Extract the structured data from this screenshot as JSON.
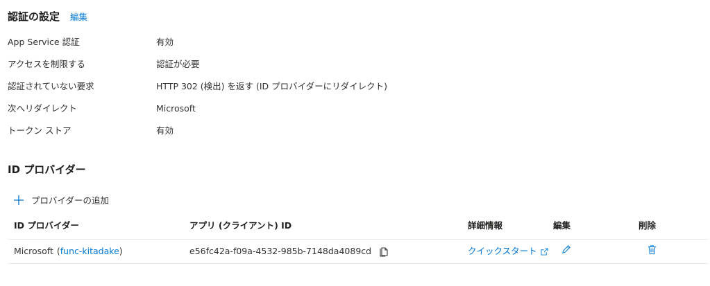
{
  "auth_settings": {
    "title": "認証の設定",
    "edit_label": "編集",
    "rows": [
      {
        "label": "App Service 認証",
        "value": "有効"
      },
      {
        "label": "アクセスを制限する",
        "value": "認証が必要"
      },
      {
        "label": "認証されていない要求",
        "value": "HTTP 302 (検出) を返す (ID プロバイダーにリダイレクト)"
      },
      {
        "label": "次へリダイレクト",
        "value": "Microsoft"
      },
      {
        "label": "トークン ストア",
        "value": "有効"
      }
    ]
  },
  "identity_providers": {
    "title": "ID プロバイダー",
    "add_label": "プロバイダーの追加",
    "columns": {
      "provider": "ID プロバイダー",
      "client_id": "アプリ (クライアント) ID",
      "details": "詳細情報",
      "edit": "編集",
      "delete": "削除"
    },
    "rows": [
      {
        "provider_name": "Microsoft",
        "provider_open": "(",
        "provider_app": "func-kitadake",
        "provider_close": ")",
        "client_id": "e56fc42a-f09a-4532-985b-7148da4089cd",
        "details_link": "クイックスタート"
      }
    ]
  },
  "icons": {
    "add": "plus-icon",
    "copy": "copy-icon",
    "external": "external-link-icon",
    "edit": "pencil-icon",
    "delete": "trash-icon"
  },
  "colors": {
    "accent": "#0078d4",
    "text": "#323130",
    "divider": "#edebe9"
  }
}
